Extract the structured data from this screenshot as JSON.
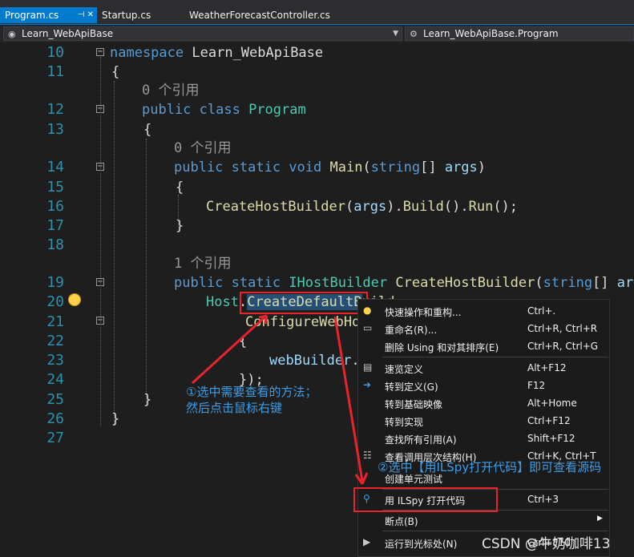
{
  "tabs": [
    {
      "label": "Program.cs",
      "active": true
    },
    {
      "label": "Startup.cs",
      "active": false
    },
    {
      "label": "WeatherForecastController.cs",
      "active": false
    }
  ],
  "tab_pin_icon": "pin-icon",
  "navbar": {
    "project": "Learn_WebApiBase",
    "class": "Learn_WebApiBase.Program"
  },
  "editor": {
    "line_numbers": [
      "10",
      "11",
      "12",
      "13",
      "14",
      "15",
      "16",
      "17",
      "18",
      "19",
      "20",
      "21",
      "22",
      "23",
      "24",
      "25",
      "26",
      "27"
    ],
    "refs": {
      "zero_a": "0 个引用",
      "zero_b": "0 个引用",
      "one": "1 个引用"
    },
    "code": {
      "l10_kw": "namespace",
      "l10_name": "Learn_WebApiBase",
      "l11": "{",
      "l12_kw": "public class",
      "l12_name": "Program",
      "l13": "{",
      "l14_kw": "public static void",
      "l14_fn": "Main",
      "l14_p1": "(",
      "l14_t": "string",
      "l14_p2": "[] ",
      "l14_arg": "args",
      "l14_p3": ")",
      "l15": "{",
      "l16_fn": "CreateHostBuilder",
      "l16_p1": "(",
      "l16_arg": "args",
      "l16_p2": ").",
      "l16_fn2": "Build",
      "l16_p3": "().",
      "l16_fn3": "Run",
      "l16_p4": "();",
      "l17": "}",
      "l19_kw": "public static",
      "l19_ty": "IHostBuilder",
      "l19_fn": "CreateHostBuilder",
      "l19_p1": "(",
      "l19_t": "string",
      "l19_p2": "[] ",
      "l19_arg": "args",
      "l20_ty": "Host",
      "l20_dot": ".",
      "l20_sel": "CreateDefaultB",
      "l20_rest": "uild",
      "l21_fn": "ConfigureWebHo",
      "l22": "{",
      "l23_arg": "webBuilder",
      "l23_rest": ".",
      "l24": "});",
      "l25": "}",
      "l26": "}"
    }
  },
  "context_menu": {
    "items": [
      {
        "label": "快速操作和重构...",
        "shortcut": "Ctrl+.",
        "icon": "lightbulb-icon"
      },
      {
        "label": "重命名(R)...",
        "shortcut": "Ctrl+R, Ctrl+R",
        "icon": "rename-icon"
      },
      {
        "label": "删除 Using 和对其排序(E)",
        "shortcut": "Ctrl+R, Ctrl+G",
        "icon": ""
      },
      {
        "label": "速览定义",
        "shortcut": "Alt+F12",
        "icon": "peek-definition-icon"
      },
      {
        "label": "转到定义(G)",
        "shortcut": "F12",
        "icon": "goto-definition-icon"
      },
      {
        "label": "转到基础映像",
        "shortcut": "Alt+Home",
        "icon": ""
      },
      {
        "label": "转到实现",
        "shortcut": "Ctrl+F12",
        "icon": ""
      },
      {
        "label": "查找所有引用(A)",
        "shortcut": "Shift+F12",
        "icon": ""
      },
      {
        "label": "查看调用层次结构(H)",
        "shortcut": "Ctrl+K, Ctrl+T",
        "icon": "call-hierarchy-icon"
      },
      {
        "label": "创建单元测试",
        "shortcut": "",
        "icon": ""
      },
      {
        "label": "用 ILSpy 打开代码",
        "shortcut": "Ctrl+3",
        "icon": "ilspy-icon"
      },
      {
        "label": "断点(B)",
        "shortcut": "",
        "icon": "",
        "submenu": true
      },
      {
        "label": "运行到光标处(N)",
        "shortcut": "Ctrl+F10",
        "icon": "run-to-cursor-icon"
      }
    ],
    "submenu_arrow": "▶"
  },
  "annotations": {
    "step1": "①选中需要查看的方法；\n然后点击鼠标右键",
    "step2": "②选中【用ILSpy打开代码】即可查看源码"
  },
  "watermark": "CSDN @牛奶咖啡13",
  "colors": {
    "accent": "#007acc",
    "annotation": "#3c9ee8",
    "highlight_box": "#e8242a",
    "keyword": "#569cd6",
    "type": "#4ec9b0",
    "method": "#dcdcaa",
    "param": "#9cdcfe",
    "line_number": "#2b91af"
  }
}
